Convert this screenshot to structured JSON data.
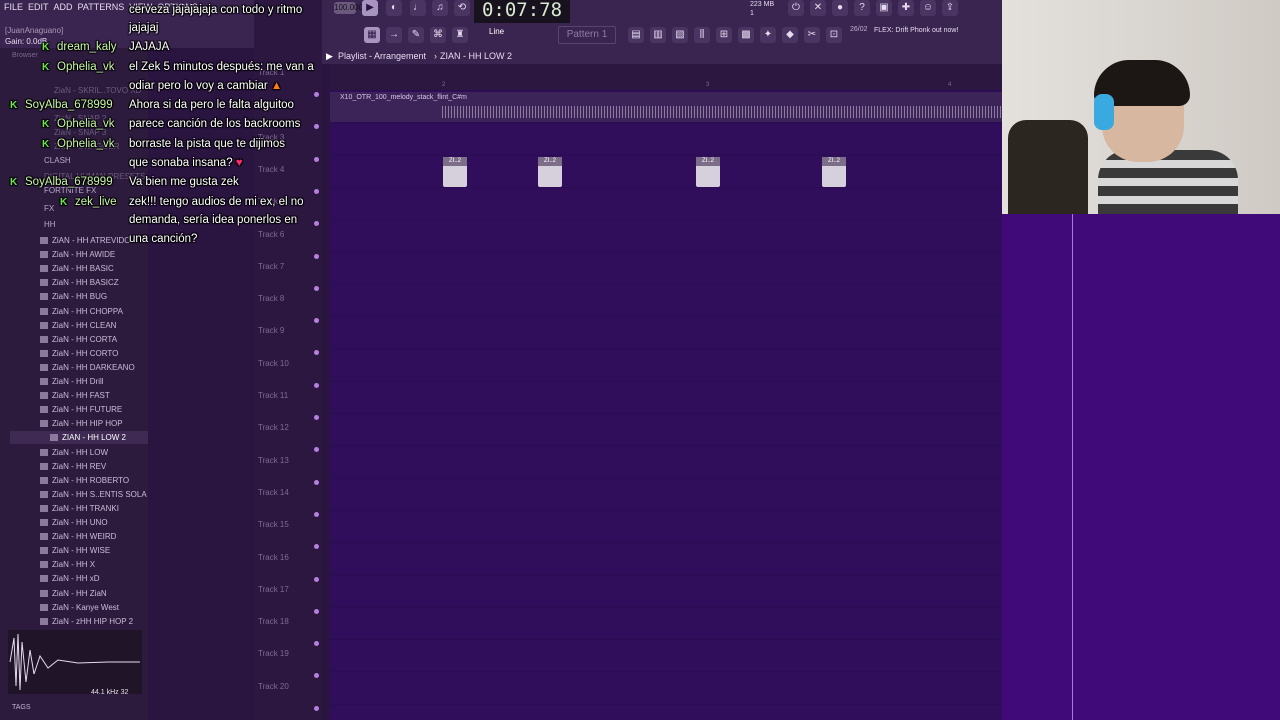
{
  "menu": [
    "FILE",
    "EDIT",
    "ADD",
    "PATTERNS",
    "VIEW",
    "OPTIONS",
    "TOOLS",
    "HELP"
  ],
  "topbar": {
    "song_position_hint": "[JuanAnaguano]",
    "gain": "Gain: 0.0dB",
    "tempo": "100.000",
    "time": "0:07:78",
    "cpu_memory": "223 MB",
    "cpu_count": "1",
    "line_mode": "Line",
    "pattern": "Pattern 1",
    "hint_date": "26/02",
    "hint_msg": "FLEX: Drift Phonk out now!"
  },
  "browser": {
    "title": "Browser",
    "folders": [
      "CLASH",
      "FORTNITE FX",
      "FX",
      "HH"
    ],
    "faded_items": [
      "ZiaN - SKRIL..TOVO XD",
      "ZiaN - SNAP 2",
      "ZiaN - SNAP 3",
      "ZiaN - SWAGGER",
      "DIGITAL HUMAN PRESETS"
    ],
    "items": [
      "ZiAN - HH ATREVIDO",
      "ZiaN - HH AWIDE",
      "ZiaN - HH BASIC",
      "ZiaN - HH BASICZ",
      "ZiaN - HH BUG",
      "ZiaN - HH CHOPPA",
      "ZiaN - HH CLEAN",
      "ZiaN - HH CORTA",
      "ZiaN - HH CORTO",
      "ZiaN - HH DARKEANO",
      "ZiaN - HH Drill",
      "ZiaN - HH FAST",
      "ZiaN - HH FUTURE",
      "ZiaN - HH HIP HOP",
      "ZIAN - HH LOW 2",
      "ZiaN - HH LOW",
      "ZiaN - HH REV",
      "ZiaN - HH ROBERTO",
      "ZiaN - HH S..ENTIS SOLA",
      "ZiaN - HH TRANKI",
      "ZiaN - HH UNO",
      "ZiaN - HH WEIRD",
      "ZiaN - HH WISE",
      "ZiaN - HH X",
      "ZiaN - HH xD",
      "ZiaN - HH ZiaN",
      "ZiaN - Kanye West",
      "ZiaN - zHH HIP HOP 2"
    ],
    "selected_index": 14,
    "sample_info": "44.1 kHz 32",
    "tags": "TAGS"
  },
  "chat": [
    {
      "user": "",
      "text": "cerveza jajajajaja con todo y ritmo"
    },
    {
      "user": "",
      "text": "jajajaj"
    },
    {
      "user": "dream_kaly",
      "text": "JAJAJA"
    },
    {
      "user": "Ophelia_vk",
      "text": "el Zek 5 minutos después: me van a"
    },
    {
      "user": "",
      "text": "odiar pero lo voy a cambiar"
    },
    {
      "user": "SoyAlba_678999",
      "text": "Ahora si da pero le falta alguitoo"
    },
    {
      "user": "Ophelia_vk",
      "text": "parece canción de los backrooms"
    },
    {
      "user": "Ophelia_vk",
      "text": "borraste la pista que te dijimos"
    },
    {
      "user": "",
      "text": "que sonaba insana?"
    },
    {
      "user": "SoyAlba_678999",
      "text": "Va bien me gusta zek"
    },
    {
      "user": "zek_live",
      "text": "zek!!! tengo audios de mi ex, el no"
    },
    {
      "user": "",
      "text": "demanda, sería idea ponerlos en"
    },
    {
      "user": "",
      "text": "una canción?"
    }
  ],
  "playlist": {
    "title": "Playlist - Arrangement",
    "breadcrumb": "ZIAN - HH LOW 2",
    "audio_clip": "X10_OTR_100_melody_stack_flint_C#m",
    "tracks": [
      "Track 1",
      "Track 2",
      "Track 3",
      "Track 4",
      "Track 5",
      "Track 6",
      "Track 7",
      "Track 8",
      "Track 9",
      "Track 10",
      "Track 11",
      "Track 12",
      "Track 13",
      "Track 14",
      "Track 15",
      "Track 16",
      "Track 17",
      "Track 18",
      "Track 19",
      "Track 20"
    ],
    "pattern_clip_label": "ZI..2",
    "timeline_marks": [
      "2",
      "3",
      "4"
    ]
  },
  "colors": {
    "playlist_bg": "#310e5c",
    "browser_bg": "#2d1b3e",
    "playhead": "#b070f0",
    "chat_user_green": "#6be64c"
  }
}
